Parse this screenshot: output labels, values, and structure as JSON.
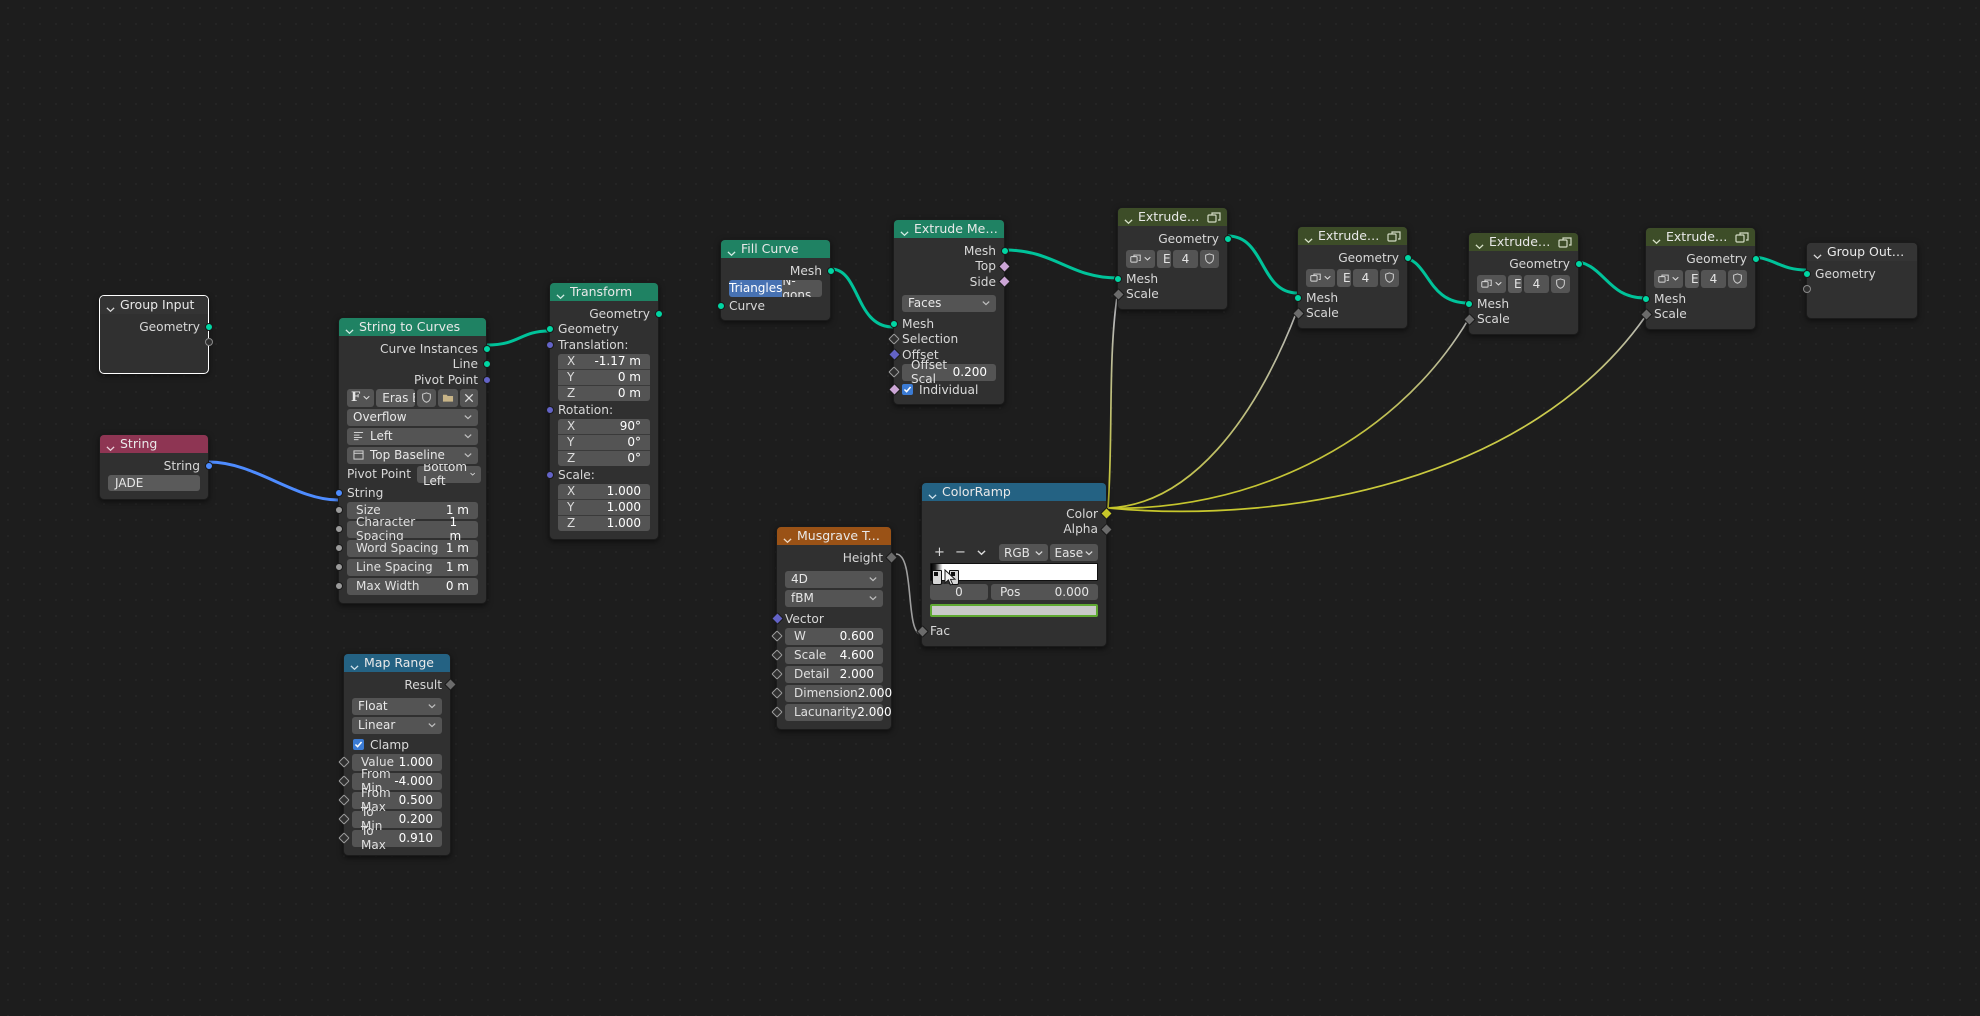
{
  "app": {
    "editor": "Blender Geometry Node Editor",
    "background": "#1d1d1d"
  },
  "colors": {
    "header_geometry": "#1f8263",
    "header_group": "#3d4d28",
    "header_input": "#8e3553",
    "header_texture": "#9a5216",
    "header_converter": "#246283",
    "socket_geometry": "#00d6a3",
    "socket_string": "#4e8cff",
    "socket_vector": "#6363c7",
    "socket_color": "#c7c729",
    "socket_boolean": "#cca6d6",
    "socket_float": "#9b9b9b",
    "wire_geometry": "#00c39a",
    "wire_string": "#4e8cff",
    "wire_field": "#c7c729",
    "accent_blue": "#4772b3",
    "checkbox_blue": "#3b7bd4",
    "swatch_outline": "#5fa832"
  },
  "nodes": {
    "group_input": {
      "title": "Group Input",
      "outputs": [
        {
          "label": "Geometry",
          "socket": "geometry"
        },
        {
          "label": "",
          "socket": "virtual"
        }
      ]
    },
    "string": {
      "title": "String",
      "outputs": [
        {
          "label": "String",
          "socket": "string"
        }
      ],
      "value": "JADE"
    },
    "string_to_curves": {
      "title": "String to Curves",
      "outputs": [
        {
          "label": "Curve Instances",
          "socket": "geometry"
        },
        {
          "label": "Line",
          "socket": "geometry"
        },
        {
          "label": "Pivot Point",
          "socket": "vector"
        }
      ],
      "font_button": "F",
      "font_name": "Eras Bold IT...",
      "overflow": "Overflow",
      "align_x": "Left",
      "align_y": "Top Baseline",
      "pivot_label": "Pivot Point",
      "pivot_value": "Bottom Left",
      "inputs": [
        {
          "label": "String",
          "socket": "string"
        }
      ],
      "values": [
        {
          "key": "Size",
          "value": "1 m"
        },
        {
          "key": "Character Spacing",
          "value": "1 m"
        },
        {
          "key": "Word Spacing",
          "value": "1 m"
        },
        {
          "key": "Line Spacing",
          "value": "1 m"
        },
        {
          "key": "Max Width",
          "value": "0 m"
        }
      ]
    },
    "transform": {
      "title": "Transform",
      "outputs": [
        {
          "label": "Geometry",
          "socket": "geometry"
        }
      ],
      "inputs": [
        {
          "label": "Geometry",
          "socket": "geometry"
        }
      ],
      "translation_label": "Translation:",
      "translation": [
        {
          "key": "X",
          "value": "-1.17 m"
        },
        {
          "key": "Y",
          "value": "0 m"
        },
        {
          "key": "Z",
          "value": "0 m"
        }
      ],
      "rotation_label": "Rotation:",
      "rotation": [
        {
          "key": "X",
          "value": "90°"
        },
        {
          "key": "Y",
          "value": "0°"
        },
        {
          "key": "Z",
          "value": "0°"
        }
      ],
      "scale_label": "Scale:",
      "scale": [
        {
          "key": "X",
          "value": "1.000"
        },
        {
          "key": "Y",
          "value": "1.000"
        },
        {
          "key": "Z",
          "value": "1.000"
        }
      ]
    },
    "fill_curve": {
      "title": "Fill Curve",
      "outputs": [
        {
          "label": "Mesh",
          "socket": "geometry"
        }
      ],
      "mode_options": [
        "Triangles",
        "N-gons"
      ],
      "mode_selected": "Triangles",
      "inputs": [
        {
          "label": "Curve",
          "socket": "geometry"
        }
      ]
    },
    "extrude_mesh": {
      "title": "Extrude Mesh",
      "outputs": [
        {
          "label": "Mesh",
          "socket": "geometry"
        },
        {
          "label": "Top",
          "socket": "boolean"
        },
        {
          "label": "Side",
          "socket": "boolean"
        }
      ],
      "mode": "Faces",
      "inputs": [
        {
          "label": "Mesh",
          "socket": "geometry"
        },
        {
          "label": "Selection",
          "socket": "boolean"
        },
        {
          "label": "Offset",
          "socket": "vector"
        }
      ],
      "offset_scale_key": "Offset Scal",
      "offset_scale_value": "0.200",
      "individual_label": "Individual",
      "individual_checked": true
    },
    "extrude_and_scale_1": {
      "title": "Extrude and Scale",
      "outputs": [
        {
          "label": "Geometry",
          "socket": "geometry"
        }
      ],
      "group_name": "Extru...",
      "users": "4",
      "inputs": [
        {
          "label": "Mesh",
          "socket": "geometry"
        },
        {
          "label": "Scale",
          "socket": "float"
        }
      ]
    },
    "extrude_and_scale_2": {
      "title": "Extrude and Scale",
      "outputs": [
        {
          "label": "Geometry",
          "socket": "geometry"
        }
      ],
      "group_name": "Extru...",
      "users": "4",
      "inputs": [
        {
          "label": "Mesh",
          "socket": "geometry"
        },
        {
          "label": "Scale",
          "socket": "float"
        }
      ]
    },
    "extrude_and_scale_3": {
      "title": "Extrude and Scale",
      "outputs": [
        {
          "label": "Geometry",
          "socket": "geometry"
        }
      ],
      "group_name": "Extru...",
      "users": "4",
      "inputs": [
        {
          "label": "Mesh",
          "socket": "geometry"
        },
        {
          "label": "Scale",
          "socket": "float"
        }
      ]
    },
    "extrude_and_scale_4": {
      "title": "Extrude and Scale",
      "outputs": [
        {
          "label": "Geometry",
          "socket": "geometry"
        }
      ],
      "group_name": "Extru...",
      "users": "4",
      "inputs": [
        {
          "label": "Mesh",
          "socket": "geometry"
        },
        {
          "label": "Scale",
          "socket": "float"
        }
      ]
    },
    "group_output": {
      "title": "Group Output",
      "inputs": [
        {
          "label": "Geometry",
          "socket": "geometry"
        },
        {
          "label": "",
          "socket": "virtual"
        }
      ]
    },
    "colorramp": {
      "title": "ColorRamp",
      "outputs": [
        {
          "label": "Color",
          "socket": "color"
        },
        {
          "label": "Alpha",
          "socket": "float"
        }
      ],
      "tools": {
        "add": "+",
        "remove": "−",
        "menu": "v"
      },
      "color_mode": "RGB",
      "interpolation": "Ease",
      "stop_index": "0",
      "pos_key": "Pos",
      "pos_value": "0.000",
      "inputs": [
        {
          "label": "Fac",
          "socket": "float"
        }
      ]
    },
    "musgrave_texture": {
      "title": "Musgrave Texture",
      "outputs": [
        {
          "label": "Height",
          "socket": "float"
        }
      ],
      "dimensions": "4D",
      "musgrave_type": "fBM",
      "inputs": [
        {
          "label": "Vector",
          "socket": "vector"
        }
      ],
      "values": [
        {
          "key": "W",
          "value": "0.600"
        },
        {
          "key": "Scale",
          "value": "4.600"
        },
        {
          "key": "Detail",
          "value": "2.000"
        },
        {
          "key": "Dimension",
          "value": "2.000"
        },
        {
          "key": "Lacunarity",
          "value": "2.000"
        }
      ]
    },
    "map_range": {
      "title": "Map Range",
      "outputs": [
        {
          "label": "Result",
          "socket": "float"
        }
      ],
      "data_type": "Float",
      "interpolation": "Linear",
      "clamp_label": "Clamp",
      "clamp_checked": true,
      "values": [
        {
          "key": "Value",
          "value": "1.000"
        },
        {
          "key": "From Min",
          "value": "-4.000"
        },
        {
          "key": "From Max",
          "value": "0.500"
        },
        {
          "key": "To Min",
          "value": "0.200"
        },
        {
          "key": "To Max",
          "value": "0.910"
        }
      ]
    }
  }
}
